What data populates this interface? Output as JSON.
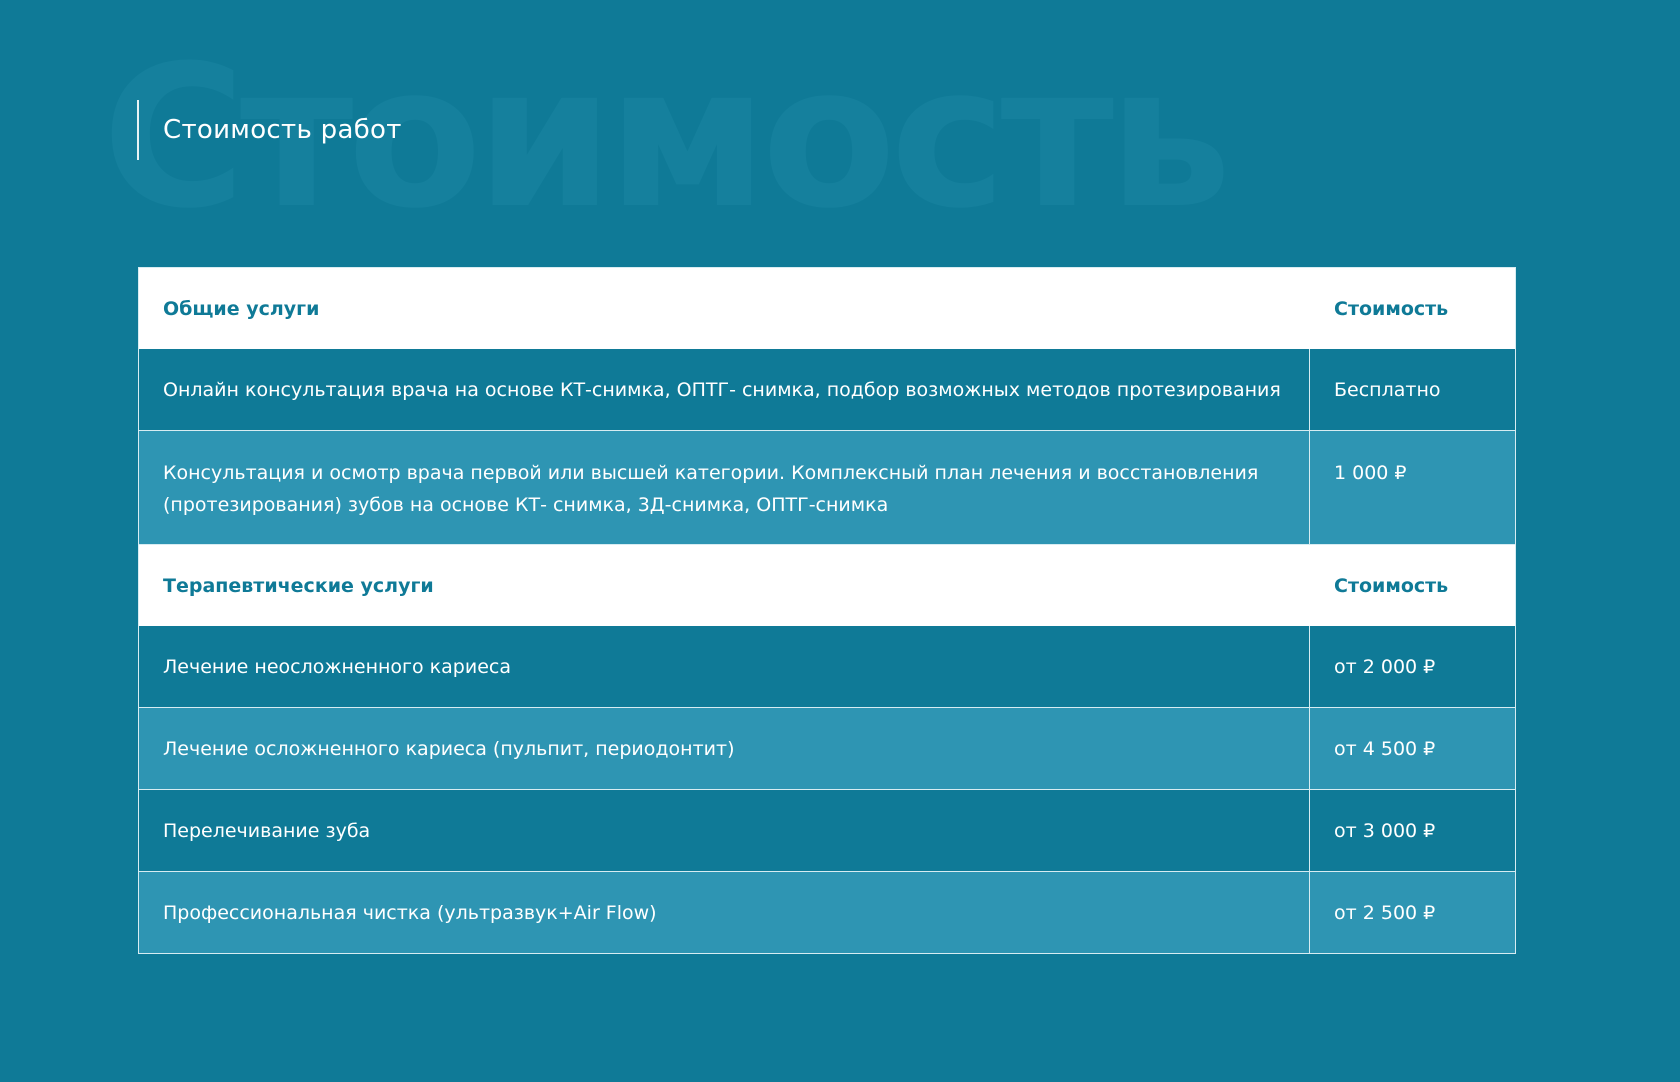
{
  "watermark": "Стоимость",
  "section_title": "Стоимость работ",
  "groups": [
    {
      "heading": "Общие услуги",
      "price_heading": "Стоимость",
      "rows": [
        {
          "name": "Онлайн консультация врача на основе КТ-снимка, ОПТГ- снимка, подбор возможных методов протезирования",
          "price": "Бесплатно"
        },
        {
          "name": "Консультация и осмотр врача первой или высшей категории. Комплексный план лечения и восстановления (протезирования) зубов на основе КТ- снимка, 3Д-снимка, ОПТГ-снимка",
          "price": "1 000 ₽"
        }
      ]
    },
    {
      "heading": "Терапевтические услуги",
      "price_heading": "Стоимость",
      "rows": [
        {
          "name": "Лечение неосложненного кариеса",
          "price": "от 2 000 ₽"
        },
        {
          "name": "Лечение осложненного кариеса (пульпит, периодонтит)",
          "price": "от 4 500 ₽"
        },
        {
          "name": "Перелечивание зуба",
          "price": "от 3 000 ₽"
        },
        {
          "name": "Профессиональная чистка (ультразвук+Air Flow)",
          "price": "от 2 500 ₽"
        }
      ]
    }
  ],
  "colors": {
    "background": "#0f7a97",
    "row_dark": "#0f7a97",
    "row_light": "#2e95b3",
    "header_bg": "#ffffff",
    "header_text": "#0f7a97",
    "border": "#d7ecf2"
  }
}
